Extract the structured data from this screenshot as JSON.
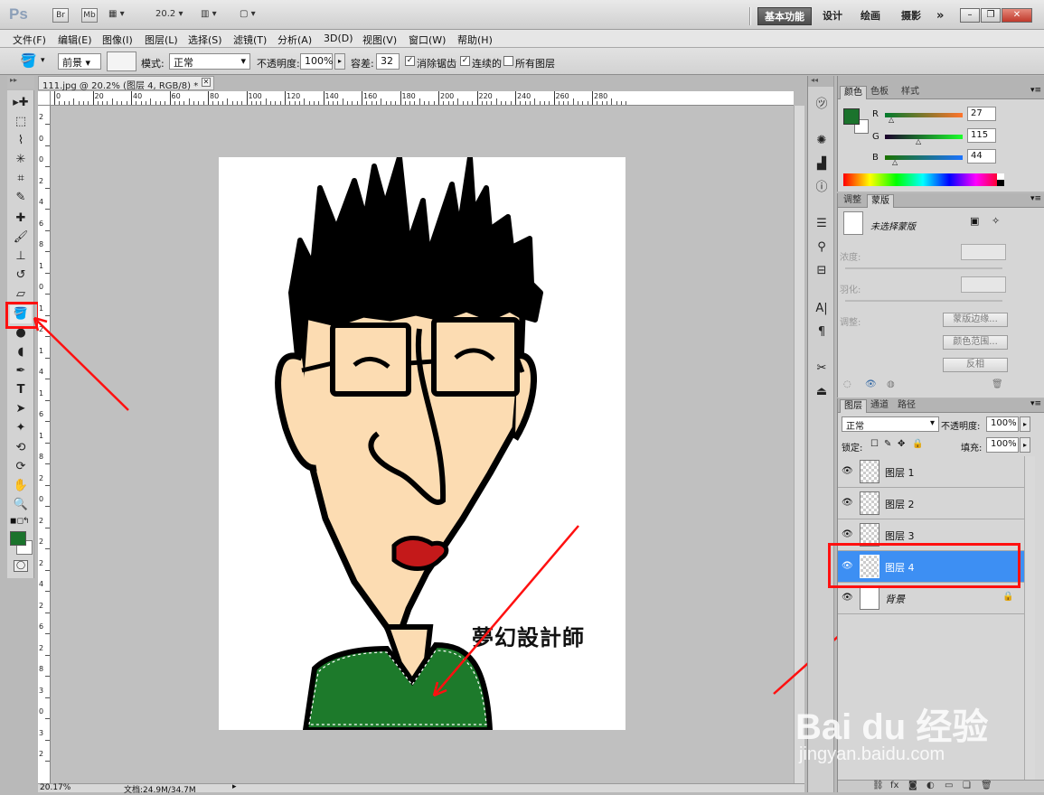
{
  "appbar": {
    "logo": "Ps",
    "bridge_label": "Br",
    "minibridge_label": "Mb",
    "zoom_value": "20.2",
    "workspaces": [
      "基本功能",
      "设计",
      "绘画",
      "摄影"
    ],
    "more_label": "»"
  },
  "menu": [
    "文件(F)",
    "编辑(E)",
    "图像(I)",
    "图层(L)",
    "选择(S)",
    "滤镜(T)",
    "分析(A)",
    "3D(D)",
    "视图(V)",
    "窗口(W)",
    "帮助(H)"
  ],
  "options": {
    "fill_source": "前景",
    "mode_label": "模式:",
    "mode_value": "正常",
    "opacity_label": "不透明度:",
    "opacity_value": "100%",
    "tolerance_label": "容差:",
    "tolerance_value": "32",
    "antialias_label": "消除锯齿",
    "contiguous_label": "连续的",
    "all_layers_label": "所有图层"
  },
  "document": {
    "tab_title": "111.jpg @ 20.2% (图层 4, RGB/8) *",
    "ruler_top": [
      "0",
      "20",
      "40",
      "60",
      "80",
      "100",
      "120",
      "140",
      "160",
      "180",
      "200",
      "220",
      "240",
      "260",
      "280"
    ],
    "ruler_left": [
      "2",
      "0",
      "0",
      "2",
      "4",
      "6",
      "8",
      "1",
      "0",
      "1",
      "2",
      "1",
      "4",
      "1",
      "6",
      "1",
      "8",
      "2",
      "0",
      "2",
      "2",
      "2",
      "4",
      "2",
      "6",
      "2",
      "8",
      "3",
      "0",
      "3",
      "2"
    ],
    "artwork_text": "夢幻設計師",
    "status_zoom": "20.17%",
    "status_doc": "文档:24.9M/34.7M"
  },
  "colors": {
    "foreground": "#1b732c",
    "background": "#ffffff",
    "tool_highlight": "#ff1010",
    "layer_selected": "#3d8ff3"
  },
  "color_panel": {
    "tabs": [
      "颜色",
      "色板",
      "样式"
    ],
    "r_label": "R",
    "r_value": "27",
    "g_label": "G",
    "g_value": "115",
    "b_label": "B",
    "b_value": "44"
  },
  "masks_panel": {
    "tabs": [
      "调整",
      "蒙版"
    ],
    "no_mask": "未选择蒙版",
    "density_label": "浓度:",
    "feather_label": "羽化:",
    "refine_label": "调整:",
    "mask_edge": "蒙版边缘...",
    "color_range": "颜色范围...",
    "invert": "反相"
  },
  "layers_panel": {
    "tabs": [
      "图层",
      "通道",
      "路径"
    ],
    "blend_mode": "正常",
    "opacity_label": "不透明度:",
    "opacity_value": "100%",
    "lock_label": "锁定:",
    "fill_label": "填充:",
    "fill_value": "100%",
    "layers": [
      {
        "name": "图层 1",
        "selected": false
      },
      {
        "name": "图层 2",
        "selected": false
      },
      {
        "name": "图层 3",
        "selected": false
      },
      {
        "name": "图层 4",
        "selected": true
      },
      {
        "name": "背景",
        "selected": false
      }
    ]
  },
  "watermark": {
    "brand": "Bai du 经验",
    "url": "jingyan.baidu.com"
  }
}
